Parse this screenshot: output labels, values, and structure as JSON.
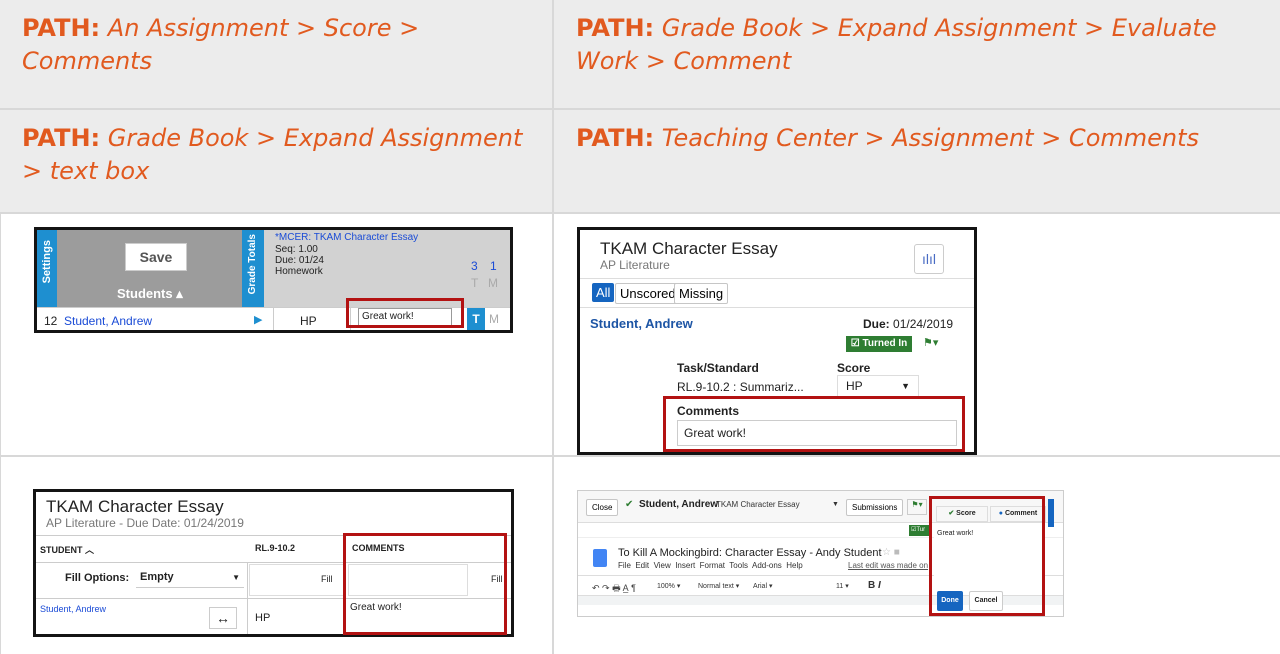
{
  "paths": [
    {
      "label": "PATH:",
      "text": "An Assignment > Score > Comments"
    },
    {
      "label": "PATH:",
      "text": "Grade Book > Expand Assignment > Evaluate Work > Comment"
    },
    {
      "label": "PATH:",
      "text": "Grade Book > Expand Assignment > text box"
    },
    {
      "label": "PATH:",
      "text": "Teaching Center > Assignment > Comments"
    }
  ],
  "shot1": {
    "settings": "Settings",
    "save": "Save",
    "students": "Students",
    "grade_totals": "Grade Totals",
    "assignment_title": "*MCER: TKAM Character Essay",
    "seq": "Seq: 1.00",
    "due": "Due: 01/24",
    "category": "Homework",
    "count_1": "3",
    "count_2": "1",
    "flag_t": "T",
    "flag_m": "M",
    "row_num": "12",
    "student": "Student, Andrew",
    "score": "HP",
    "comment": "Great work!",
    "row_t": "T",
    "row_m": "M"
  },
  "shot2": {
    "title": "TKAM Character Essay",
    "subtitle": "AP Literature",
    "tab_all": "All",
    "tab_unscored": "Unscored",
    "tab_missing": "Missing",
    "student": "Student, Andrew",
    "due_label": "Due:",
    "due_value": "01/24/2019",
    "turned_in": "Turned In",
    "task_header": "Task/Standard",
    "score_header": "Score",
    "task_value": "RL.9-10.2 : Summariz...",
    "score_value": "HP",
    "comments_label": "Comments",
    "comment": "Great work!"
  },
  "shot3": {
    "title": "TKAM Character Essay",
    "subtitle": "AP Literature - Due Date: 01/24/2019",
    "col_student": "STUDENT",
    "col_standard": "RL.9-10.2",
    "col_comments": "COMMENTS",
    "fill_options_label": "Fill Options:",
    "fill_options_value": "Empty",
    "fill_1": "Fill",
    "fill_2": "Fill",
    "student": "Student, Andrew",
    "score": "HP",
    "comment": "Great work!"
  },
  "shot4": {
    "close": "Close",
    "student": "Student, Andrew",
    "assignment": "TKAM Character Essay",
    "submissions": "Submissions",
    "score_btn": "Score",
    "comment_btn": "Comment",
    "turned_in": "Tur",
    "doc_title": "To Kill A Mockingbird: Character Essay - Andy Student",
    "menus": "File  Edit  View  Insert  Format  Tools  Add-ons  Help",
    "last_edit": "Last edit was made on",
    "zoom": "100%",
    "style": "Normal text",
    "font": "Arial",
    "size": "11",
    "comment": "Great work!",
    "done": "Done",
    "cancel": "Cancel"
  }
}
